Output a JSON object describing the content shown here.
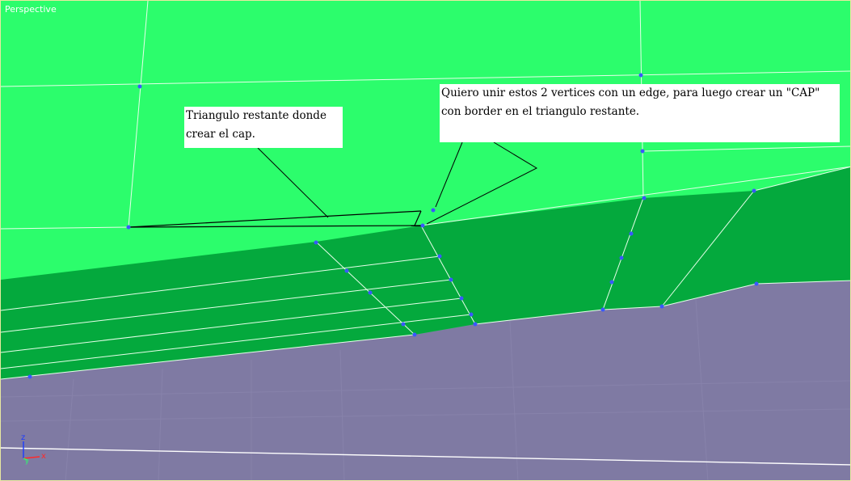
{
  "viewport": {
    "label": "Perspective"
  },
  "annotations": {
    "left_note": "Triangulo restante donde crear el cap.",
    "right_note": "Quiero unir estos 2 vertices con un edge, para luego crear un \"CAP\" con border en el triangulo restante."
  },
  "axis_gizmo": {
    "z": "z",
    "x": "x",
    "y": "y"
  },
  "colors": {
    "background_light_green": "#2cfd6c",
    "mesh_dark_green": "#04a93d",
    "ground_purple": "#7f7aa3",
    "wire_white": "#e6ffe9",
    "vertex_blue": "#3a58ff",
    "viewport_border": "#e8e8a0"
  },
  "icons": {
    "vertex": "vertex-dot",
    "axis": "axis-gizmo"
  }
}
